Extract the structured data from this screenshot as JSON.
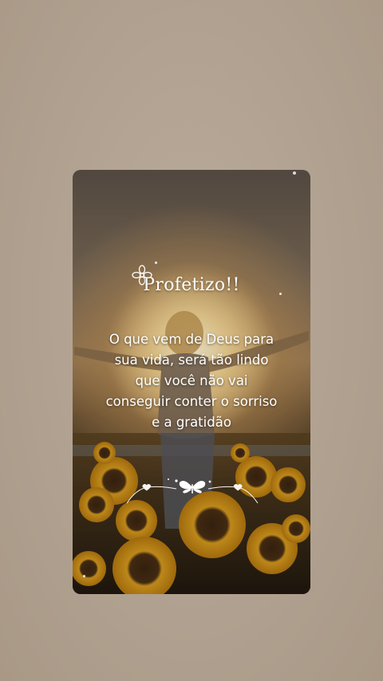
{
  "post": {
    "brand": "Profetizo!!",
    "message_lines": [
      "O que vem de Deus para",
      "sua vida, será tão lindo",
      "que você não vai",
      "conseguir conter o sorriso",
      "e a gratidão"
    ]
  },
  "icons": {
    "flower": "flower-outline-icon",
    "ornament": "butterfly-hearts-ornament"
  },
  "colors": {
    "page_background": "#b3a392",
    "text": "#ffffff",
    "sunflower": "#d9a21f"
  }
}
